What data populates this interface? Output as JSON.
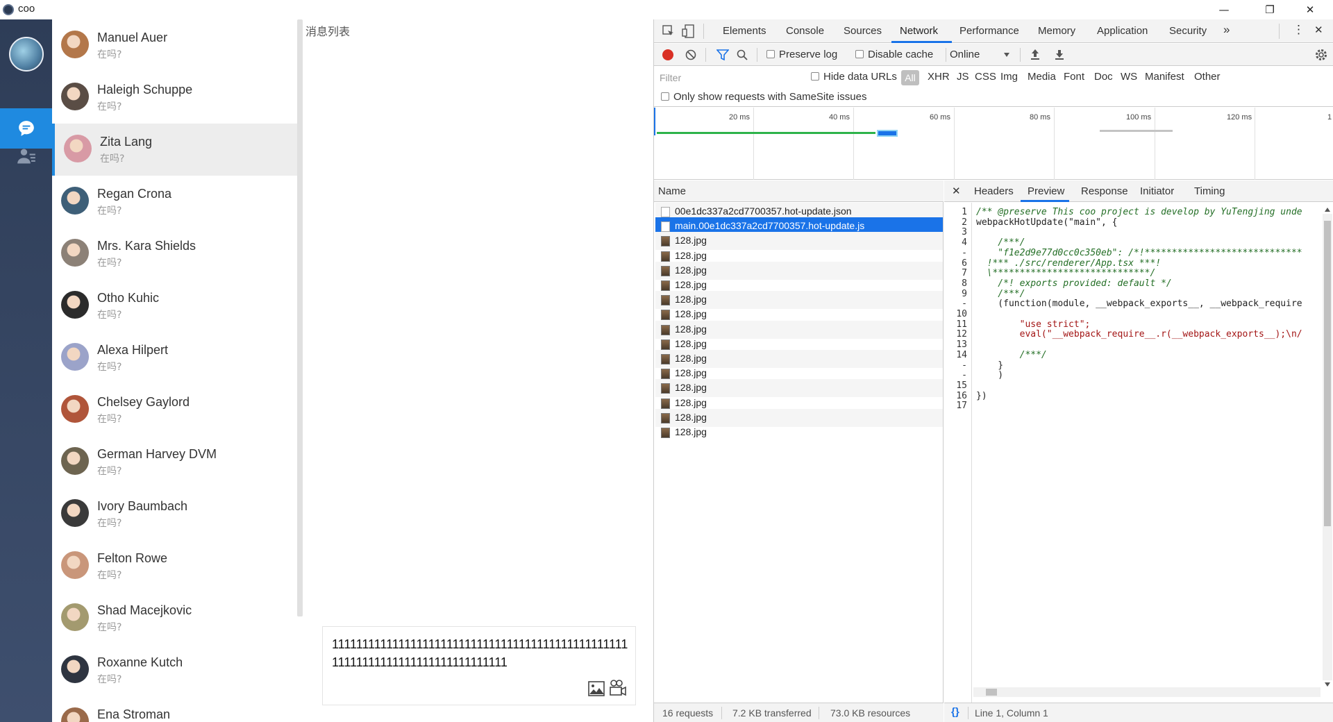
{
  "app": {
    "title": "coo"
  },
  "window": {
    "minimize": "—",
    "restore": "❐",
    "close": "✕"
  },
  "contacts": {
    "items": [
      {
        "name": "Manuel Auer",
        "preview": "在吗?",
        "color": "#b3774a"
      },
      {
        "name": "Haleigh Schuppe",
        "preview": "在吗?",
        "color": "#5a4d45"
      },
      {
        "name": "Zita Lang",
        "preview": "在吗?",
        "color": "#d89aa5"
      },
      {
        "name": "Regan Crona",
        "preview": "在吗?",
        "color": "#3e5f78"
      },
      {
        "name": "Mrs. Kara Shields",
        "preview": "在吗?",
        "color": "#8c8177"
      },
      {
        "name": "Otho Kuhic",
        "preview": "在吗?",
        "color": "#2b2b2b"
      },
      {
        "name": "Alexa Hilpert",
        "preview": "在吗?",
        "color": "#9ba3c9"
      },
      {
        "name": "Chelsey Gaylord",
        "preview": "在吗?",
        "color": "#b0553a"
      },
      {
        "name": "German Harvey DVM",
        "preview": "在吗?",
        "color": "#6d6450"
      },
      {
        "name": "Ivory Baumbach",
        "preview": "在吗?",
        "color": "#3a3a3a"
      },
      {
        "name": "Felton Rowe",
        "preview": "在吗?",
        "color": "#c9967a"
      },
      {
        "name": "Shad Macejkovic",
        "preview": "在吗?",
        "color": "#a39a6f"
      },
      {
        "name": "Roxanne Kutch",
        "preview": "在吗?",
        "color": "#2e3440"
      },
      {
        "name": "Ena Stroman",
        "preview": "在吗?",
        "color": "#9a6a4a"
      }
    ]
  },
  "chat": {
    "title": "消息列表",
    "input_value": "111111111111111111111111111111111111111111111111111111111111111111111111111111"
  },
  "devtools": {
    "tabs": [
      "Elements",
      "Console",
      "Sources",
      "Network",
      "Performance",
      "Memory",
      "Application",
      "Security"
    ],
    "more": "»",
    "menu": "⋮",
    "close": "✕",
    "toolbar": {
      "preserve_log": "Preserve log",
      "disable_cache": "Disable cache",
      "throttle": "Online"
    },
    "filter": {
      "placeholder": "Filter",
      "hide_data_urls": "Hide data URLs",
      "types": [
        "All",
        "XHR",
        "JS",
        "CSS",
        "Img",
        "Media",
        "Font",
        "Doc",
        "WS",
        "Manifest",
        "Other"
      ],
      "samesite": "Only show requests with SameSite issues"
    },
    "timeline": {
      "ticks": [
        "20 ms",
        "40 ms",
        "60 ms",
        "80 ms",
        "100 ms",
        "120 ms",
        "1"
      ]
    },
    "requests": {
      "column": "Name",
      "rows": [
        "00e1dc337a2cd7700357.hot-update.json",
        "main.00e1dc337a2cd7700357.hot-update.js",
        "128.jpg",
        "128.jpg",
        "128.jpg",
        "128.jpg",
        "128.jpg",
        "128.jpg",
        "128.jpg",
        "128.jpg",
        "128.jpg",
        "128.jpg",
        "128.jpg",
        "128.jpg",
        "128.jpg",
        "128.jpg"
      ],
      "selected_index": 1
    },
    "preview": {
      "close": "✕",
      "tabs": [
        "Headers",
        "Preview",
        "Response",
        "Initiator",
        "Timing"
      ],
      "line_numbers": [
        "1",
        "2",
        "3",
        "4",
        "-",
        "6",
        "7",
        "8",
        "9",
        "-",
        "10",
        "11",
        "12",
        "13",
        "14",
        "-",
        "-",
        "15",
        "16",
        "17"
      ],
      "code": [
        "/** @preserve This coo project is develop by YuTengjing unde",
        "webpackHotUpdate(\"main\", {",
        "",
        "    /***/",
        "    \"f1e2d9e77d0cc0c350eb\": /*!*****************************",
        "  !*** ./src/renderer/App.tsx ***!",
        "  \\*****************************/",
        "    /*! exports provided: default */",
        "    /***/",
        "    (function(module, __webpack_exports__, __webpack_require",
        "",
        "        \"use strict\";",
        "        eval(\"__webpack_require__.r(__webpack_exports__);\\n/",
        "",
        "        /***/",
        "    }",
        "    )",
        "",
        "})",
        ""
      ]
    },
    "status": {
      "requests": "16 requests",
      "transferred": "7.2 KB transferred",
      "resources": "73.0 KB resources",
      "format_icon": "{}",
      "cursor": "Line 1, Column 1"
    }
  }
}
